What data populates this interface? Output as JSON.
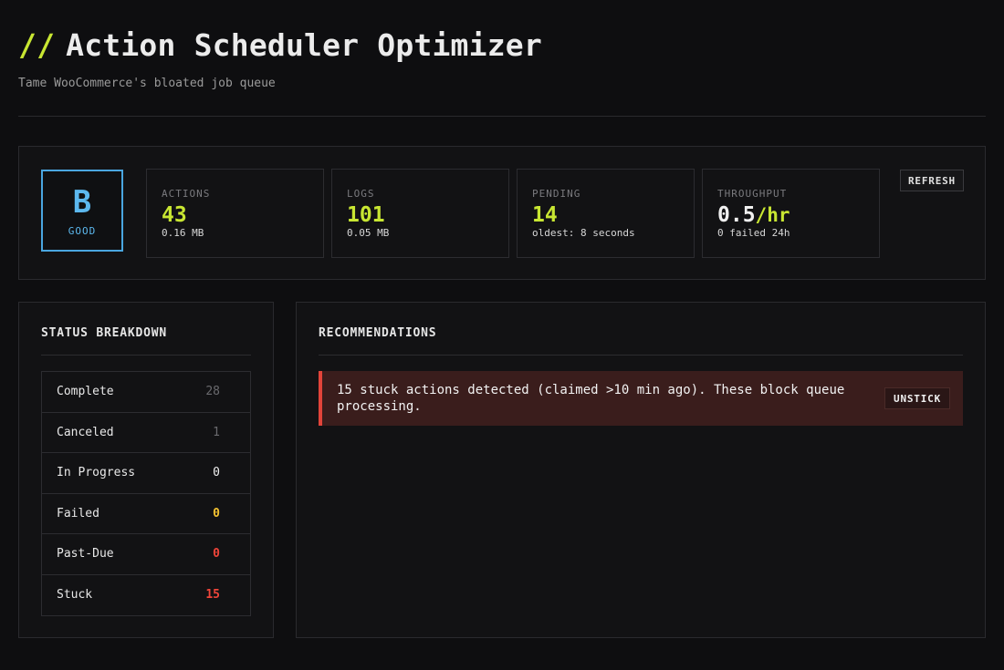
{
  "header": {
    "slashes": "//",
    "title": "Action Scheduler Optimizer",
    "subtitle": "Tame WooCommerce's bloated job queue"
  },
  "grade": {
    "letter": "B",
    "label": "GOOD",
    "color": "#5cb8ee"
  },
  "stats": [
    {
      "label": "ACTIONS",
      "value": "43",
      "sub": "0.16 MB"
    },
    {
      "label": "LOGS",
      "value": "101",
      "sub": "0.05 MB"
    },
    {
      "label": "PENDING",
      "value": "14",
      "sub": "oldest: 8 seconds"
    },
    {
      "label": "THROUGHPUT",
      "value": "0.5",
      "unit": "/hr",
      "sub": "0 failed 24h"
    }
  ],
  "refresh_label": "REFRESH",
  "status_breakdown": {
    "title": "STATUS BREAKDOWN",
    "rows": [
      {
        "name": "Complete",
        "count": "28"
      },
      {
        "name": "Canceled",
        "count": "1"
      },
      {
        "name": "In Progress",
        "count": "0"
      },
      {
        "name": "Failed",
        "count": "0"
      },
      {
        "name": "Past-Due",
        "count": "0"
      },
      {
        "name": "Stuck",
        "count": "15"
      }
    ]
  },
  "recommendations": {
    "title": "RECOMMENDATIONS",
    "alerts": [
      {
        "text": "15 stuck actions detected (claimed >10 min ago). These block queue processing.",
        "action": "UNSTICK"
      }
    ]
  },
  "colors": {
    "accent": "#c8e632",
    "danger": "#f0453a",
    "warning": "#f5c331",
    "info": "#4aa6e0"
  }
}
